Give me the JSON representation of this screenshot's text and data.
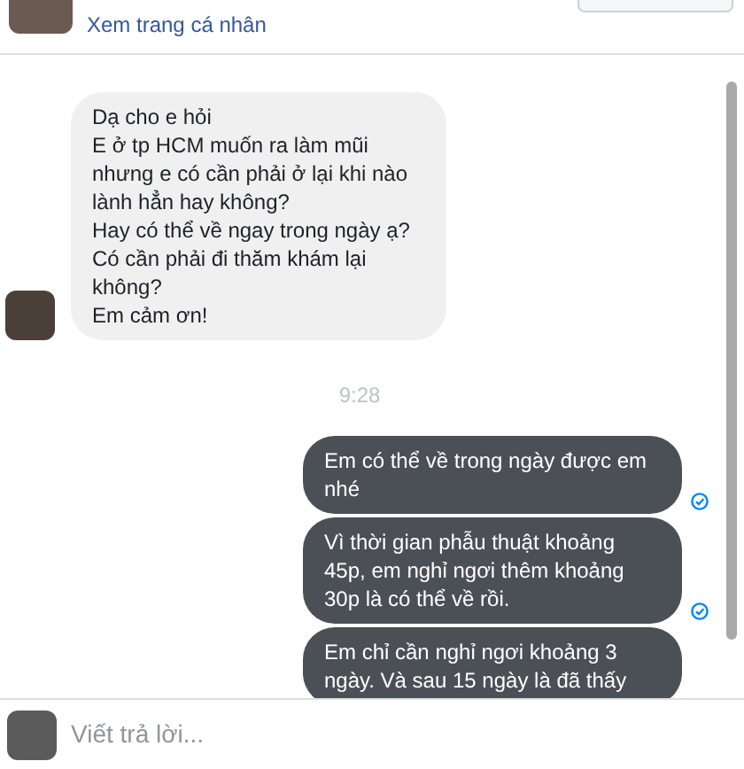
{
  "header": {
    "profile_link": "Xem trang cá nhân"
  },
  "messages": [
    {
      "kind": "incoming",
      "text": "Dạ cho e hỏi\nE ở tp HCM muốn ra làm mũi\nnhưng e có cần phải ở lại khi nào lành hẳn hay không?\nHay có thể về ngay trong ngày ạ?\nCó cần phải đi thăm khám lại không?\nEm cảm ơn!"
    },
    {
      "kind": "timestamp",
      "text": "9:28"
    },
    {
      "kind": "outgoing",
      "text": "Em có thể về trong ngày được em nhé",
      "seen": true
    },
    {
      "kind": "outgoing",
      "text": "Vì thời gian phẫu thuật khoảng 45p, em nghỉ ngơi thêm khoảng 30p là có thể về rồi.",
      "seen": true
    },
    {
      "kind": "outgoing",
      "text": "Em chỉ cần nghỉ ngơi khoảng 3 ngày. Và sau 15 ngày là đã thấy"
    }
  ],
  "composer": {
    "placeholder": "Viết trả lời..."
  }
}
